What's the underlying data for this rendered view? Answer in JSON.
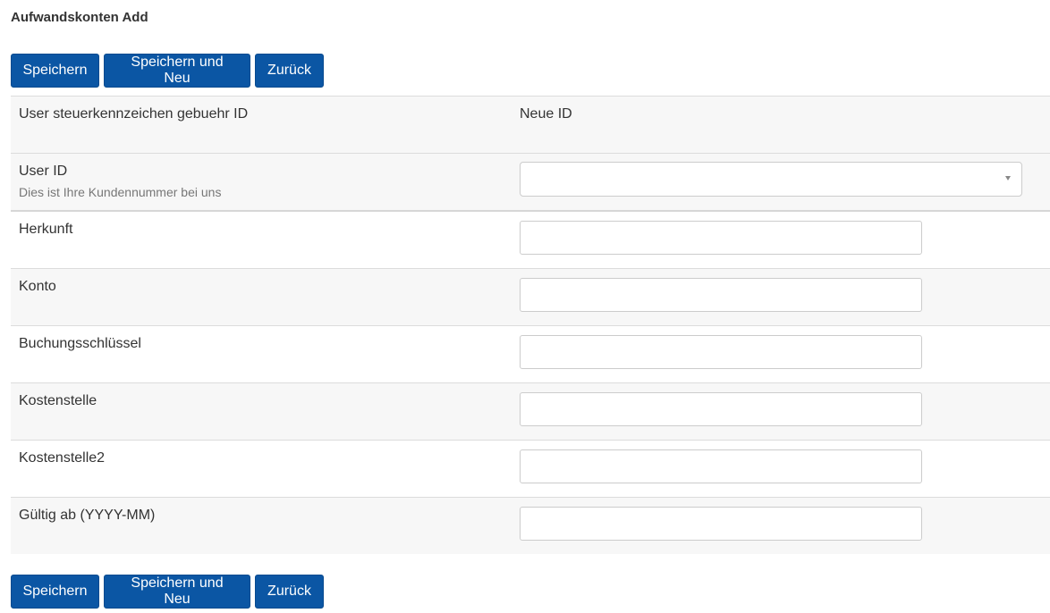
{
  "page": {
    "title": "Aufwandskonten Add"
  },
  "buttons": {
    "save": "Speichern",
    "save_new": "Speichern und Neu",
    "back": "Zurück"
  },
  "form": {
    "fields": [
      {
        "label": "User steuerkennzeichen gebuehr ID",
        "value": "Neue ID"
      },
      {
        "label": "User ID",
        "hint": "Dies ist Ihre Kundennummer bei uns",
        "value": ""
      },
      {
        "label": "Herkunft",
        "value": ""
      },
      {
        "label": "Konto",
        "value": ""
      },
      {
        "label": "Buchungsschlüssel",
        "value": ""
      },
      {
        "label": "Kostenstelle",
        "value": ""
      },
      {
        "label": "Kostenstelle2",
        "value": ""
      },
      {
        "label": "Gültig ab (YYYY-MM)",
        "value": ""
      }
    ]
  },
  "colors": {
    "button_bg": "#0b56a4",
    "row_shade": "#f7f7f7",
    "border": "#dcdcdc"
  }
}
